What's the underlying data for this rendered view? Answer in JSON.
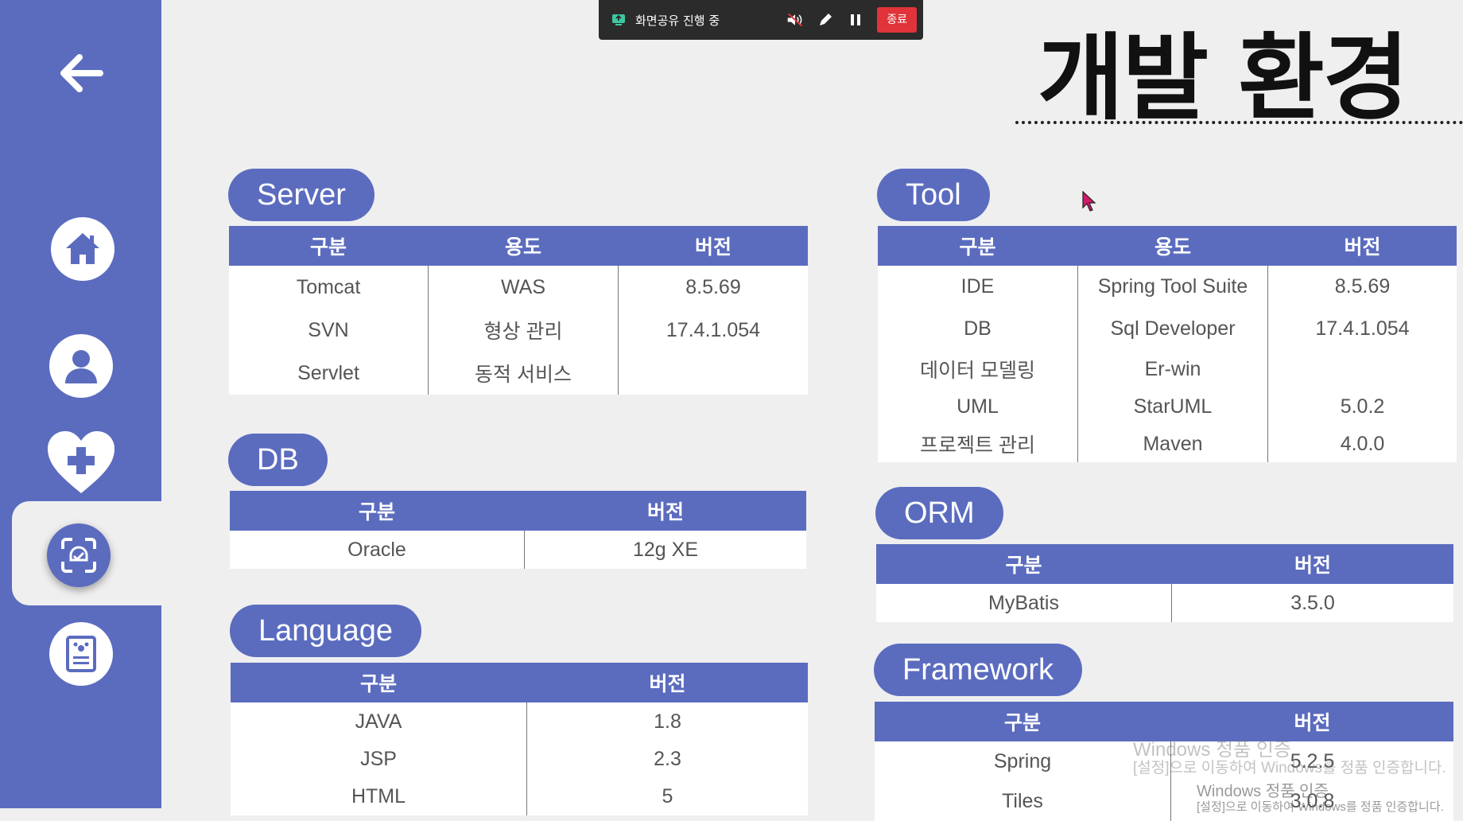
{
  "topbar": {
    "status": "화면공유 진행 중",
    "end_label": "종료"
  },
  "page_title": "개발 환경",
  "server": {
    "title": "Server",
    "headers": [
      "구분",
      "용도",
      "버전"
    ],
    "rows": [
      [
        "Tomcat",
        "WAS",
        "8.5.69"
      ],
      [
        "SVN",
        "형상 관리",
        "17.4.1.054"
      ],
      [
        "Servlet",
        "동적 서비스",
        ""
      ]
    ]
  },
  "db": {
    "title": "DB",
    "headers": [
      "구분",
      "버전"
    ],
    "rows": [
      [
        "Oracle",
        "12g XE"
      ]
    ]
  },
  "language": {
    "title": "Language",
    "headers": [
      "구분",
      "버전"
    ],
    "rows": [
      [
        "JAVA",
        "1.8"
      ],
      [
        "JSP",
        "2.3"
      ],
      [
        "HTML",
        "5"
      ]
    ]
  },
  "tool": {
    "title": "Tool",
    "headers": [
      "구분",
      "용도",
      "버전"
    ],
    "rows": [
      [
        "IDE",
        "Spring Tool Suite",
        "8.5.69"
      ],
      [
        "DB",
        "Sql Developer",
        "17.4.1.054"
      ],
      [
        "데이터 모델링",
        "Er-win",
        ""
      ],
      [
        "UML",
        "StarUML",
        "5.0.2"
      ],
      [
        "프로젝트 관리",
        "Maven",
        "4.0.0"
      ]
    ]
  },
  "orm": {
    "title": "ORM",
    "headers": [
      "구분",
      "버전"
    ],
    "rows": [
      [
        "MyBatis",
        "3.5.0"
      ]
    ]
  },
  "framework": {
    "title": "Framework",
    "headers": [
      "구분",
      "버전"
    ],
    "rows": [
      [
        "Spring",
        "5.2.5"
      ],
      [
        "Tiles",
        "3.0.8"
      ]
    ]
  },
  "watermark": {
    "line1": "Windows 정품 인증",
    "line2": "[설정]으로 이동하여 Windows를 정품 인증합니다.",
    "line3": "Windows 정품 인증",
    "line4": "[설정]으로 이동하여 Windows를 정품 인증합니다."
  },
  "colors": {
    "accent": "#5b6cbf",
    "background": "#efefef",
    "end_button": "#e0343a"
  },
  "icons": [
    "back-arrow-icon",
    "home-icon",
    "user-icon",
    "heart-plus-icon",
    "scan-check-icon",
    "document-paw-icon",
    "share-screen-icon",
    "mute-icon",
    "pen-icon",
    "pause-icon",
    "cursor-icon"
  ]
}
